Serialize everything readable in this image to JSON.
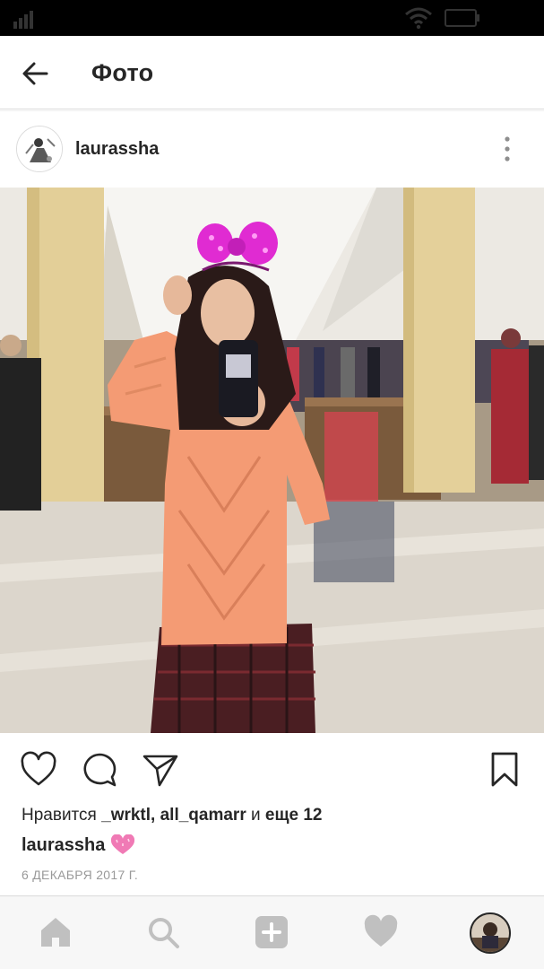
{
  "status_bar": {
    "signal_icon": "signal-icon",
    "wifi_icon": "wifi-icon",
    "battery_icon": "battery-icon"
  },
  "header": {
    "back_icon": "arrow-left-icon",
    "title": "Фото"
  },
  "post": {
    "username": "laurassha",
    "more_icon": "more-vertical-icon",
    "photo_icon": "photo-image",
    "actions": {
      "like_icon": "heart-outline-icon",
      "comment_icon": "comment-icon",
      "share_icon": "send-icon",
      "save_icon": "bookmark-icon"
    },
    "likes": {
      "prefix": "Нравится",
      "users": "_wrktl, all_qamarr",
      "conjunction": "и",
      "more": "еще 12"
    },
    "caption": {
      "username": "laurassha",
      "emoji": "sparkling-heart-emoji"
    },
    "date": "6 ДЕКАБРЯ 2017 Г."
  },
  "bottom_nav": [
    "home-icon",
    "search-icon",
    "add-post-icon",
    "activity-heart-icon",
    "profile-avatar"
  ],
  "colors": {
    "text": "#262626",
    "muted": "#999999",
    "divider": "#dbdbdb",
    "nav_bg": "#f7f7f7",
    "nav_icon": "#c0c0c0"
  }
}
